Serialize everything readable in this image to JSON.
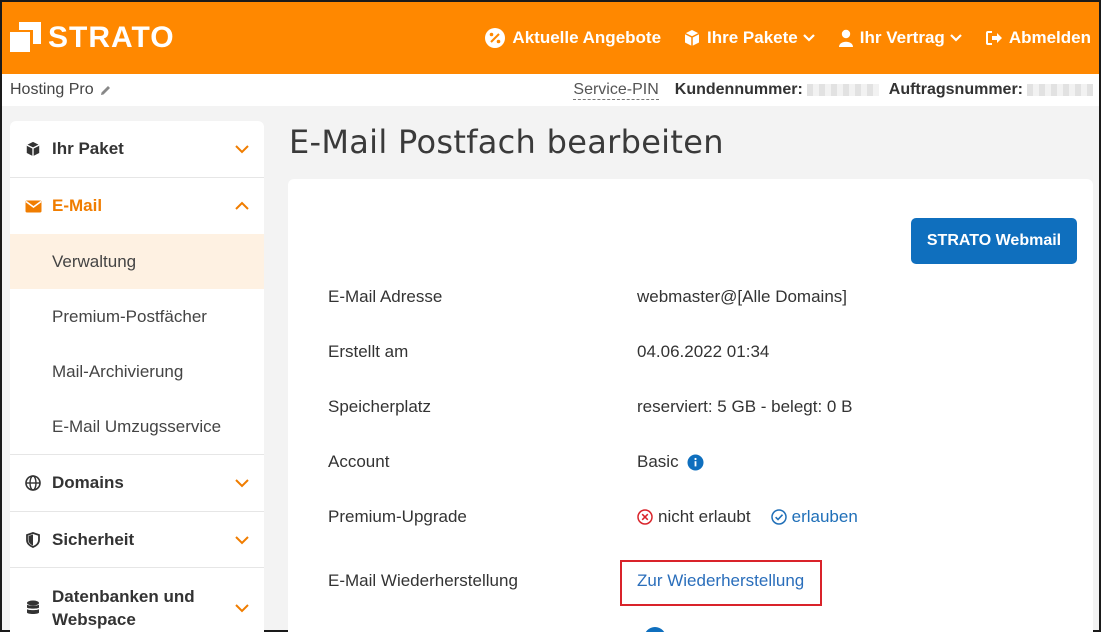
{
  "brand": {
    "name": "STRATO",
    "color": "#ff8800"
  },
  "topnav": {
    "offers": "Aktuelle Angebote",
    "packages": "Ihre Pakete",
    "contract": "Ihr Vertrag",
    "logout": "Abmelden"
  },
  "subbar": {
    "package_name": "Hosting Pro",
    "service_pin": "Service-PIN",
    "customer_number_label": "Kundennummer:",
    "order_number_label": "Auftragsnummer:"
  },
  "sidebar": {
    "sections": [
      {
        "label": "Ihr Paket",
        "icon": "box-icon",
        "expanded": false
      },
      {
        "label": "E-Mail",
        "icon": "envelope-icon",
        "expanded": true,
        "items": [
          "Verwaltung",
          "Premium-Postfächer",
          "Mail-Archivierung",
          "E-Mail Umzugsservice"
        ],
        "current": "Verwaltung"
      },
      {
        "label": "Domains",
        "icon": "globe-icon",
        "expanded": false
      },
      {
        "label": "Sicherheit",
        "icon": "shield-icon",
        "expanded": false
      },
      {
        "label": "Datenbanken und Webspace",
        "icon": "database-icon",
        "expanded": false
      }
    ]
  },
  "main": {
    "title": "E-Mail Postfach bearbeiten",
    "webmail_button": "STRATO Webmail",
    "rows": [
      {
        "label": "E-Mail Adresse",
        "value": "webmaster@[Alle Domains]"
      },
      {
        "label": "Erstellt am",
        "value": "04.06.2022 01:34"
      },
      {
        "label": "Speicherplatz",
        "value": "reserviert: 5 GB - belegt: 0 B"
      },
      {
        "label": "Account",
        "value": "Basic"
      },
      {
        "label": "Premium-Upgrade",
        "status": "nicht erlaubt",
        "action": "erlauben"
      },
      {
        "label": "E-Mail Wiederherstellung",
        "link": "Zur Wiederherstellung"
      }
    ]
  },
  "colors": {
    "accent": "#f07d00",
    "primary_button": "#0f6fbe",
    "link": "#1f6fb8",
    "error": "#d9232a"
  }
}
